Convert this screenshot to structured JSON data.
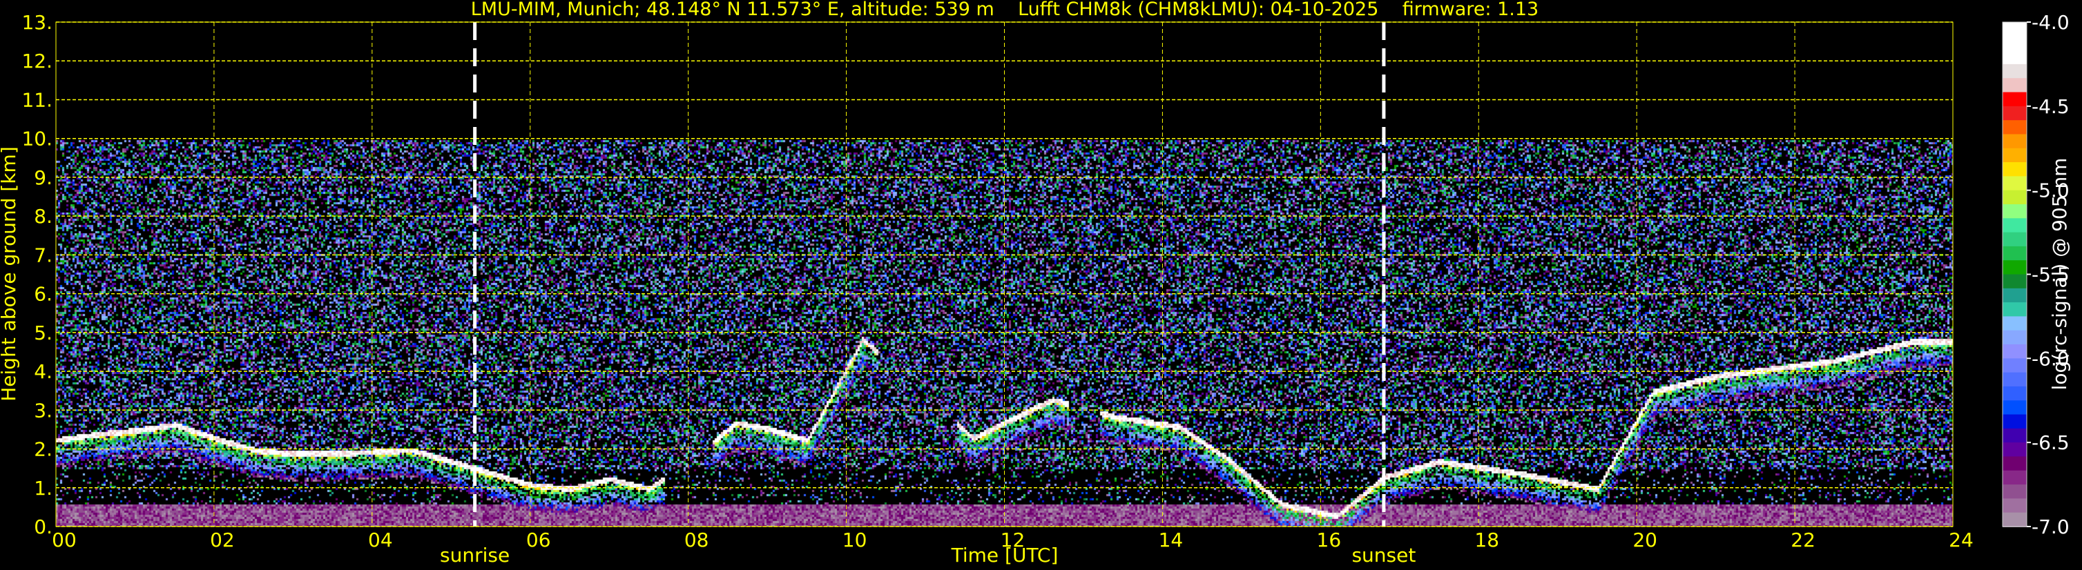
{
  "title": "LMU-MIM, Munich; 48.148° N 11.573° E, altitude: 539 m    Lufft CHM8k (CHM8kLMU): 04-10-2025    firmware: 1.13",
  "chart_data": {
    "type": "heatmap",
    "title": "LMU-MIM, Munich; 48.148° N 11.573° E, altitude: 539 m    Lufft CHM8k (CHM8kLMU): 04-10-2025    firmware: 1.13",
    "xlabel": "Time [UTC]",
    "ylabel": "Height above ground [km]",
    "xlim": [
      0,
      24
    ],
    "ylim": [
      0,
      13
    ],
    "data_top_km": 10,
    "x_ticks": [
      0,
      2,
      4,
      6,
      8,
      10,
      12,
      14,
      16,
      18,
      20,
      22,
      24
    ],
    "x_tick_labels": [
      "00",
      "02",
      "04",
      "06",
      "08",
      "10",
      "12",
      "14",
      "16",
      "18",
      "20",
      "22",
      "24"
    ],
    "y_ticks": [
      0,
      1,
      2,
      3,
      4,
      5,
      6,
      7,
      8,
      9,
      10,
      11,
      12,
      13
    ],
    "y_tick_labels": [
      "0.",
      "1.",
      "2.",
      "3.",
      "4.",
      "5.",
      "6.",
      "7.",
      "8.",
      "9.",
      "10.",
      "11.",
      "12.",
      "13."
    ],
    "grid": true,
    "markers": [
      {
        "label": "sunrise",
        "time": 5.3
      },
      {
        "label": "sunset",
        "time": 16.8
      }
    ],
    "colorbar": {
      "label": "log(rc-signal) @ 905 nm",
      "range": [
        -7.0,
        -4.0
      ],
      "ticks": [
        -4.0,
        -4.5,
        -5.0,
        -5.5,
        -6.0,
        -6.5,
        -7.0
      ],
      "tick_labels": [
        "-4.0",
        "-4.5",
        "-5.0",
        "-5.5",
        "-6.0",
        "-6.5",
        "-7.0"
      ],
      "colors_top_to_bottom": [
        "#ffffff",
        "#ffffff",
        "#ffffff",
        "#e8e0e0",
        "#f0c4c4",
        "#ff0000",
        "#f02020",
        "#ff6000",
        "#ff9800",
        "#ffb000",
        "#ffe000",
        "#e0f840",
        "#c8f030",
        "#90ff80",
        "#40e8a0",
        "#30d080",
        "#20c050",
        "#10a800",
        "#108830",
        "#20a090",
        "#30c8a8",
        "#88c0ff",
        "#88a8ff",
        "#9090ff",
        "#7080ff",
        "#5070ff",
        "#3060ff",
        "#0050ff",
        "#0010e0",
        "#4000b0",
        "#6000a0",
        "#700070",
        "#882888",
        "#905090",
        "#a070a0",
        "#a890a8"
      ]
    },
    "cloud_layer_km": {
      "time": [
        0.0,
        0.5,
        1.0,
        1.5,
        2.0,
        2.5,
        3.0,
        3.5,
        4.0,
        4.5,
        5.0,
        5.5,
        6.0,
        6.5,
        7.0,
        7.5,
        8.0,
        8.6,
        9.0,
        9.5,
        10.2,
        11.6,
        12.6,
        13.4,
        14.2,
        14.8,
        15.5,
        16.2,
        16.8,
        17.5,
        18.5,
        19.5,
        20.2,
        21.0,
        22.5,
        23.5
      ],
      "height": [
        2.25,
        2.4,
        2.5,
        2.65,
        2.3,
        2.0,
        1.9,
        1.9,
        1.95,
        2.0,
        1.7,
        1.4,
        1.1,
        1.0,
        1.25,
        1.0,
        1.7,
        2.7,
        2.55,
        2.25,
        4.85,
        2.3,
        3.3,
        2.85,
        2.6,
        1.8,
        0.6,
        0.3,
        1.3,
        1.7,
        1.4,
        1.0,
        3.5,
        3.9,
        4.3,
        4.8
      ]
    },
    "aerosol_layer_top_km": 0.6
  }
}
